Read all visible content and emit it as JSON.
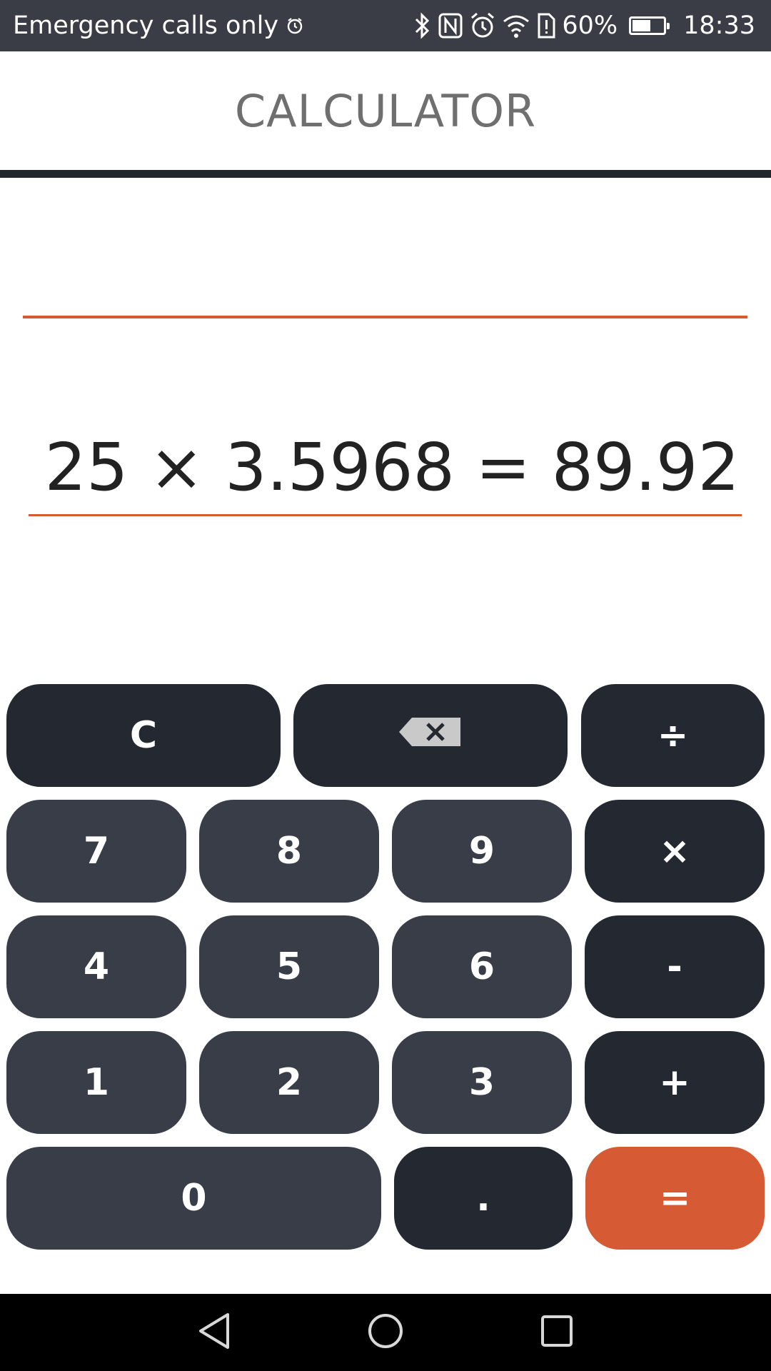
{
  "status_bar": {
    "carrier": "Emergency calls only",
    "battery_percent": "60%",
    "battery_level": 0.6,
    "time": "18:33"
  },
  "header": {
    "title": "CALCULATOR"
  },
  "display": {
    "expression": "",
    "result": "25 × 3.5968 = 89.92"
  },
  "keypad": {
    "clear": "C",
    "divide": "÷",
    "multiply": "×",
    "subtract": "-",
    "add": "+",
    "equals": "=",
    "decimal": ".",
    "digits": {
      "d0": "0",
      "d1": "1",
      "d2": "2",
      "d3": "3",
      "d4": "4",
      "d5": "5",
      "d6": "6",
      "d7": "7",
      "d8": "8",
      "d9": "9"
    }
  },
  "colors": {
    "accent": "#d65a34",
    "number_key": "#393d47",
    "operator_key": "#232831",
    "status_bar": "#3a3d45"
  },
  "icons": {
    "backspace": "backspace-icon",
    "bluetooth": "bluetooth-icon",
    "nfc": "nfc-icon",
    "alarm": "alarm-icon",
    "wifi": "wifi-icon",
    "battery": "battery-icon",
    "back": "back-icon",
    "home": "home-icon",
    "recents": "recents-icon"
  }
}
